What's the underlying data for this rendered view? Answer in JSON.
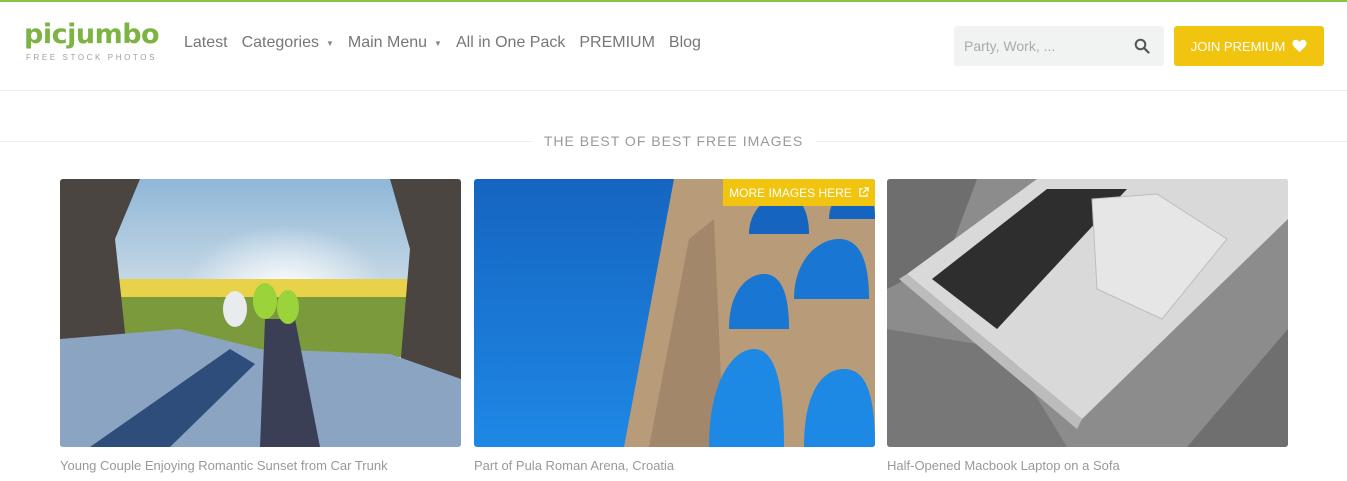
{
  "header": {
    "logo": {
      "name": "picjumbo",
      "tagline": "FREE STOCK PHOTOS"
    },
    "nav": [
      {
        "label": "Latest",
        "has_dropdown": false
      },
      {
        "label": "Categories",
        "has_dropdown": true
      },
      {
        "label": "Main Menu",
        "has_dropdown": true
      },
      {
        "label": "All in One Pack",
        "has_dropdown": false
      },
      {
        "label": "PREMIUM",
        "has_dropdown": false
      },
      {
        "label": "Blog",
        "has_dropdown": false
      }
    ],
    "search": {
      "placeholder": "Party, Work, ...",
      "value": "",
      "icon": "search-icon"
    },
    "join_button": {
      "label": "JOIN PREMIUM",
      "icon": "heart-icon"
    }
  },
  "section": {
    "title": "THE BEST OF BEST FREE IMAGES"
  },
  "gallery": [
    {
      "caption": "Young Couple Enjoying Romantic Sunset from Car Trunk"
    },
    {
      "caption": "Part of Pula Roman Arena, Croatia",
      "badge": "MORE IMAGES HERE",
      "badge_icon": "external-link-icon"
    },
    {
      "caption": "Half-Opened Macbook Laptop on a Sofa"
    }
  ],
  "colors": {
    "brand_green": "#7cb342",
    "accent_yellow": "#f1c40f",
    "top_bar": "#8bc34a"
  }
}
